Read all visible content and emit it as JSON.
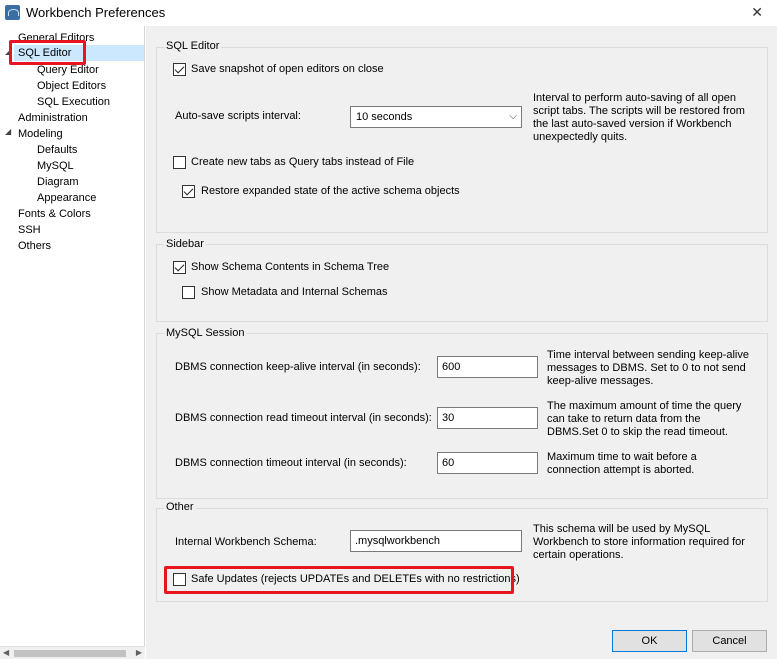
{
  "window": {
    "title": "Workbench Preferences",
    "close_glyph": "✕"
  },
  "sidebar": {
    "items": [
      {
        "label": "General Editors"
      },
      {
        "label": "SQL Editor"
      },
      {
        "label": "Query Editor"
      },
      {
        "label": "Object Editors"
      },
      {
        "label": "SQL Execution"
      },
      {
        "label": "Administration"
      },
      {
        "label": "Modeling"
      },
      {
        "label": "Defaults"
      },
      {
        "label": "MySQL"
      },
      {
        "label": "Diagram"
      },
      {
        "label": "Appearance"
      },
      {
        "label": "Fonts & Colors"
      },
      {
        "label": "SSH"
      },
      {
        "label": "Others"
      }
    ],
    "expanded_glyph": "◢",
    "scroll_left_glyph": "◀",
    "scroll_right_glyph": "▶"
  },
  "sql_editor": {
    "title": "SQL Editor",
    "save_snapshot": {
      "label": "Save snapshot of open editors on close",
      "checked": true
    },
    "autosave_label": "Auto-save scripts interval:",
    "autosave_value": "10 seconds",
    "autosave_arrow": "⌵",
    "autosave_help": [
      "Interval to perform auto-saving of all open",
      "script tabs. The scripts will be restored from",
      "the last auto-saved version if Workbench",
      "unexpectedly quits."
    ],
    "new_tabs": {
      "label": "Create new tabs as Query tabs instead of File",
      "checked": false
    },
    "restore_state": {
      "label": "Restore expanded state of the active schema objects",
      "checked": true
    }
  },
  "sidebar_group": {
    "title": "Sidebar",
    "show_schema": {
      "label": "Show Schema Contents in Schema Tree",
      "checked": true
    },
    "show_metadata": {
      "label": "Show Metadata and Internal Schemas",
      "checked": false
    }
  },
  "mysql_session": {
    "title": "MySQL Session",
    "keepalive_label": "DBMS connection keep-alive interval (in seconds):",
    "keepalive_value": "600",
    "keepalive_help": [
      "Time interval between sending keep-alive",
      "messages to DBMS. Set to 0 to not send",
      "keep-alive messages."
    ],
    "read_timeout_label": "DBMS connection read timeout interval (in seconds):",
    "read_timeout_value": "30",
    "read_timeout_help": [
      "The maximum amount of time the query",
      "can take to return data from the",
      "DBMS.Set 0 to skip the read timeout."
    ],
    "conn_timeout_label": "DBMS connection timeout interval (in seconds):",
    "conn_timeout_value": "60",
    "conn_timeout_help": [
      "Maximum time to wait before a",
      "connection attempt is aborted."
    ]
  },
  "other": {
    "title": "Other",
    "schema_label": "Internal Workbench Schema:",
    "schema_value": ".mysqlworkbench",
    "schema_help": [
      "This schema will be used by MySQL",
      "Workbench to store information required for",
      "certain operations."
    ],
    "safe_updates": {
      "label": "Safe Updates (rejects UPDATEs and DELETEs with no restrictions)",
      "checked": false
    }
  },
  "buttons": {
    "ok": "OK",
    "cancel": "Cancel"
  },
  "colors": {
    "highlight": "#e8141f",
    "selection": "#cce8ff",
    "panel": "#f0f0f0",
    "primary_border": "#0078d7"
  }
}
